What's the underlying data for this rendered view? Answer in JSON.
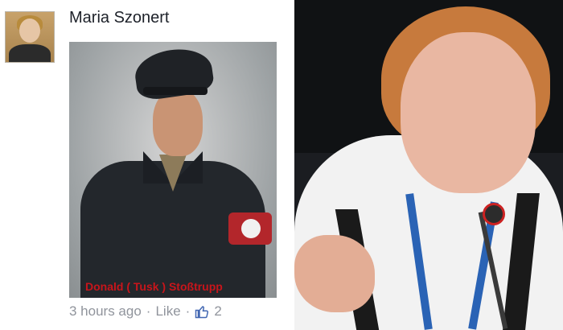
{
  "post": {
    "author_name": "Maria Szonert",
    "photo_caption": "Donald ( Tusk ) Stoßtrupp",
    "timestamp": "3 hours ago",
    "separator": "·",
    "like_label": "Like",
    "like_count": "2",
    "like_icon": "thumbs-up-icon",
    "accent_color": "#4267b2"
  }
}
